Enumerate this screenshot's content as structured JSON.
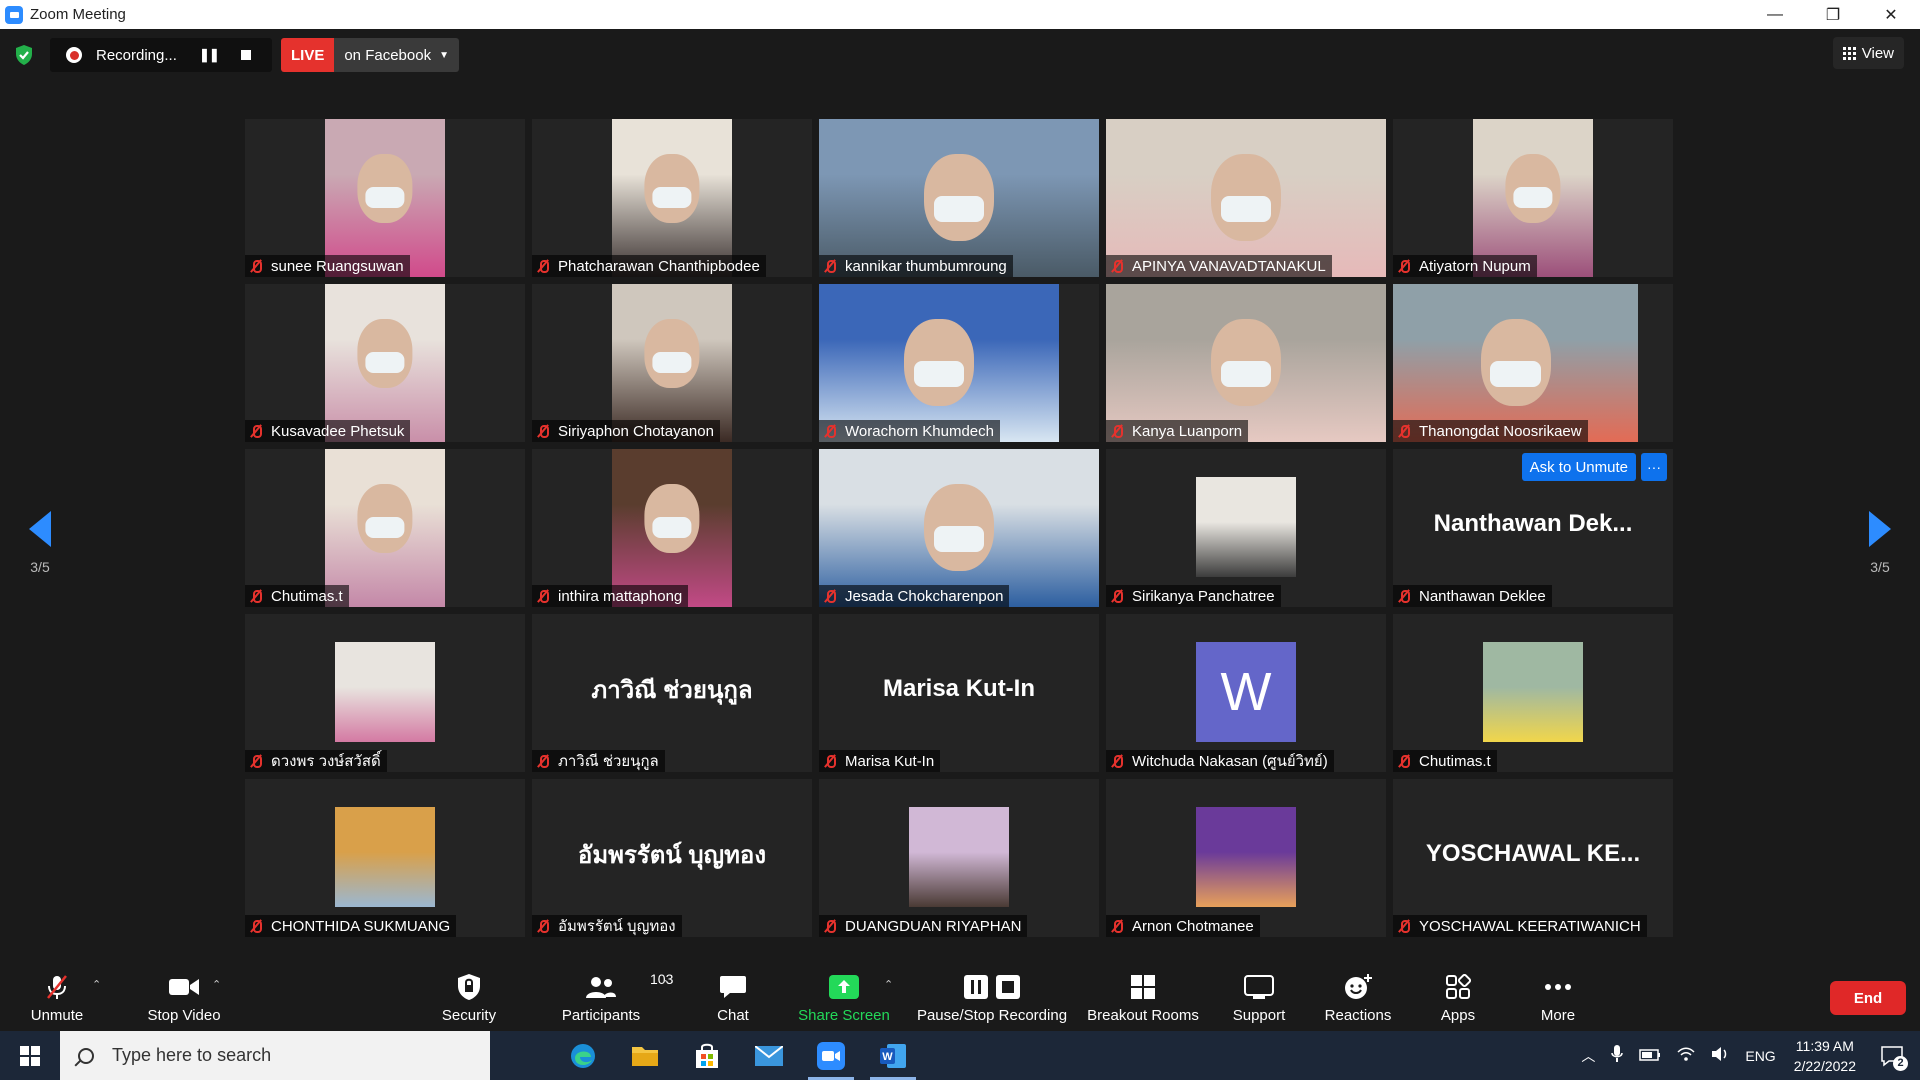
{
  "window": {
    "title": "Zoom Meeting",
    "controls": [
      "—",
      "❐",
      "✕"
    ]
  },
  "topbar": {
    "recording_label": "Recording...",
    "live_badge": "LIVE",
    "live_target": "on Facebook",
    "view_label": "View"
  },
  "pager": {
    "indicator": "3/5"
  },
  "participants": [
    {
      "name": "sunee Ruangsuwan",
      "kind": "video",
      "colors": [
        "#c9a9b3",
        "#d14a8b"
      ]
    },
    {
      "name": "Phatcharawan Chanthipbodee",
      "kind": "video",
      "colors": [
        "#e8e2d8",
        "#3a3130"
      ]
    },
    {
      "name": "kannikar thumbumroung",
      "kind": "video-full",
      "colors": [
        "#7d97b4",
        "#4a5a66"
      ]
    },
    {
      "name": "APINYA VANAVADTANAKUL",
      "kind": "video-full",
      "colors": [
        "#d8cfc4",
        "#e6b9b9"
      ]
    },
    {
      "name": "Atiyatorn Nupum",
      "kind": "video",
      "colors": [
        "#dcd4c8",
        "#9c4f7a"
      ]
    },
    {
      "name": "Kusavadee Phetsuk",
      "kind": "video",
      "colors": [
        "#e8e2dc",
        "#c98fa9"
      ]
    },
    {
      "name": "Siriyaphon Chotayanon",
      "kind": "video",
      "colors": [
        "#cfc7bd",
        "#3b2a24"
      ]
    },
    {
      "name": "Worachorn Khumdech",
      "kind": "video-wide",
      "colors": [
        "#3b67b8",
        "#d8e6f2"
      ]
    },
    {
      "name": "Kanya Luanporn",
      "kind": "video-full",
      "colors": [
        "#a9a49c",
        "#e6c9c2"
      ]
    },
    {
      "name": "Thanongdat Noosrikaew",
      "kind": "video-med",
      "colors": [
        "#8fa0a8",
        "#e36b55"
      ]
    },
    {
      "name": "Chutimas.t",
      "kind": "video",
      "colors": [
        "#e9e0d6",
        "#c488a8"
      ]
    },
    {
      "name": "inthira  mattaphong",
      "kind": "video",
      "colors": [
        "#5a3d2e",
        "#c24a86"
      ]
    },
    {
      "name": "Jesada Chokcharenpon",
      "kind": "video-full",
      "colors": [
        "#d9dfe4",
        "#2d5fa0"
      ]
    },
    {
      "name": "Sirikanya Panchatree",
      "kind": "photo",
      "colors": [
        "#e9e6e0",
        "#3c3c3c"
      ]
    },
    {
      "name": "Nanthawan Deklee",
      "kind": "name",
      "display": "Nanthawan  Dek...",
      "ask_unmute": "Ask to Unmute",
      "more": "···"
    },
    {
      "name": "ดวงพร วงษ์สวัสดิ์",
      "kind": "photo",
      "colors": [
        "#e8e4df",
        "#d47aa3"
      ]
    },
    {
      "name": "ภาวิณี ช่วยนุกูล",
      "kind": "name",
      "display": "ภาวิณี ช่วยนุกูล"
    },
    {
      "name": "Marisa Kut-In",
      "kind": "name",
      "display": "Marisa Kut-In"
    },
    {
      "name": "Witchuda Nakasan (ศูนย์วิทย์)",
      "kind": "letter",
      "letter": "W"
    },
    {
      "name": "Chutimas.t",
      "kind": "photo",
      "colors": [
        "#9fb8a2",
        "#f1d64b"
      ]
    },
    {
      "name": "CHONTHIDA SUKMUANG",
      "kind": "photo",
      "colors": [
        "#d9a04a",
        "#9bb7d1"
      ]
    },
    {
      "name": "อัมพรรัตน์ บุญทอง",
      "kind": "name",
      "display": "อัมพรรัตน์ บุญทอง"
    },
    {
      "name": "DUANGDUAN RIYAPHAN",
      "kind": "photo",
      "colors": [
        "#d1b8d6",
        "#4a3a34"
      ]
    },
    {
      "name": "Arnon Chotmanee",
      "kind": "photo",
      "colors": [
        "#6a3a9a",
        "#e8a05a"
      ]
    },
    {
      "name": "YOSCHAWAL KEERATIWANICH",
      "kind": "name",
      "display": "YOSCHAWAL  KE..."
    }
  ],
  "toolbar": {
    "unmute": "Unmute",
    "stop_video": "Stop Video",
    "security": "Security",
    "participants": "Participants",
    "participant_count": "103",
    "chat": "Chat",
    "share_screen": "Share Screen",
    "pause_stop_recording": "Pause/Stop Recording",
    "breakout_rooms": "Breakout Rooms",
    "support": "Support",
    "reactions": "Reactions",
    "apps": "Apps",
    "more": "More",
    "end": "End",
    "accent_green": "#23d959",
    "end_red": "#e02828"
  },
  "taskbar": {
    "search_placeholder": "Type here to search",
    "language": "ENG",
    "time": "11:39 AM",
    "date": "2/22/2022",
    "notification_count": "2"
  }
}
